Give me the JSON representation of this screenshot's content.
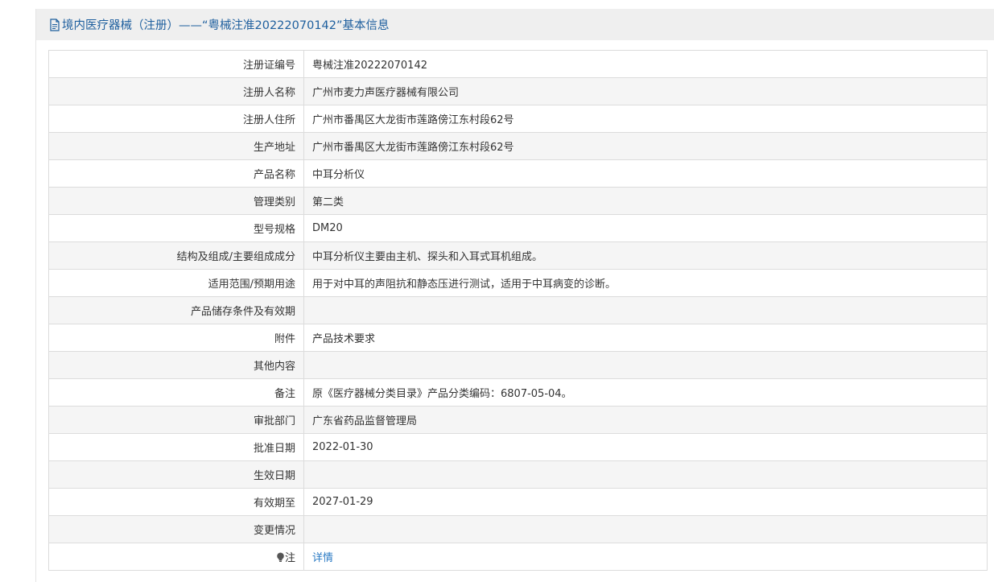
{
  "header": {
    "title": "境内医疗器械（注册）——“粤械注准20222070142”基本信息",
    "icon": "document-icon"
  },
  "rows": [
    {
      "label": "注册证编号",
      "value": "粤械注准20222070142"
    },
    {
      "label": "注册人名称",
      "value": "广州市麦力声医疗器械有限公司"
    },
    {
      "label": "注册人住所",
      "value": "广州市番禺区大龙街市莲路傍江东村段62号"
    },
    {
      "label": "生产地址",
      "value": "广州市番禺区大龙街市莲路傍江东村段62号"
    },
    {
      "label": "产品名称",
      "value": "中耳分析仪"
    },
    {
      "label": "管理类别",
      "value": "第二类"
    },
    {
      "label": "型号规格",
      "value": "DM20"
    },
    {
      "label": "结构及组成/主要组成成分",
      "value": "中耳分析仪主要由主机、探头和入耳式耳机组成。"
    },
    {
      "label": "适用范围/预期用途",
      "value": "用于对中耳的声阻抗和静态压进行测试，适用于中耳病变的诊断。"
    },
    {
      "label": "产品储存条件及有效期",
      "value": ""
    },
    {
      "label": "附件",
      "value": "产品技术要求"
    },
    {
      "label": "其他内容",
      "value": ""
    },
    {
      "label": "备注",
      "value": "原《医疗器械分类目录》产品分类编码：6807-05-04。"
    },
    {
      "label": "审批部门",
      "value": "广东省药品监督管理局"
    },
    {
      "label": "批准日期",
      "value": "2022-01-30"
    },
    {
      "label": "生效日期",
      "value": ""
    },
    {
      "label": "有效期至",
      "value": "2027-01-29"
    },
    {
      "label": "变更情况",
      "value": ""
    }
  ],
  "note_row": {
    "label": "注",
    "icon": "lightbulb-icon",
    "link_text": "详情"
  },
  "colors": {
    "header_bg": "#efefef",
    "header_text": "#1e5f9e",
    "link": "#2b7bc4",
    "stripe": "#f5f5f5",
    "border": "#dcdcdc"
  }
}
